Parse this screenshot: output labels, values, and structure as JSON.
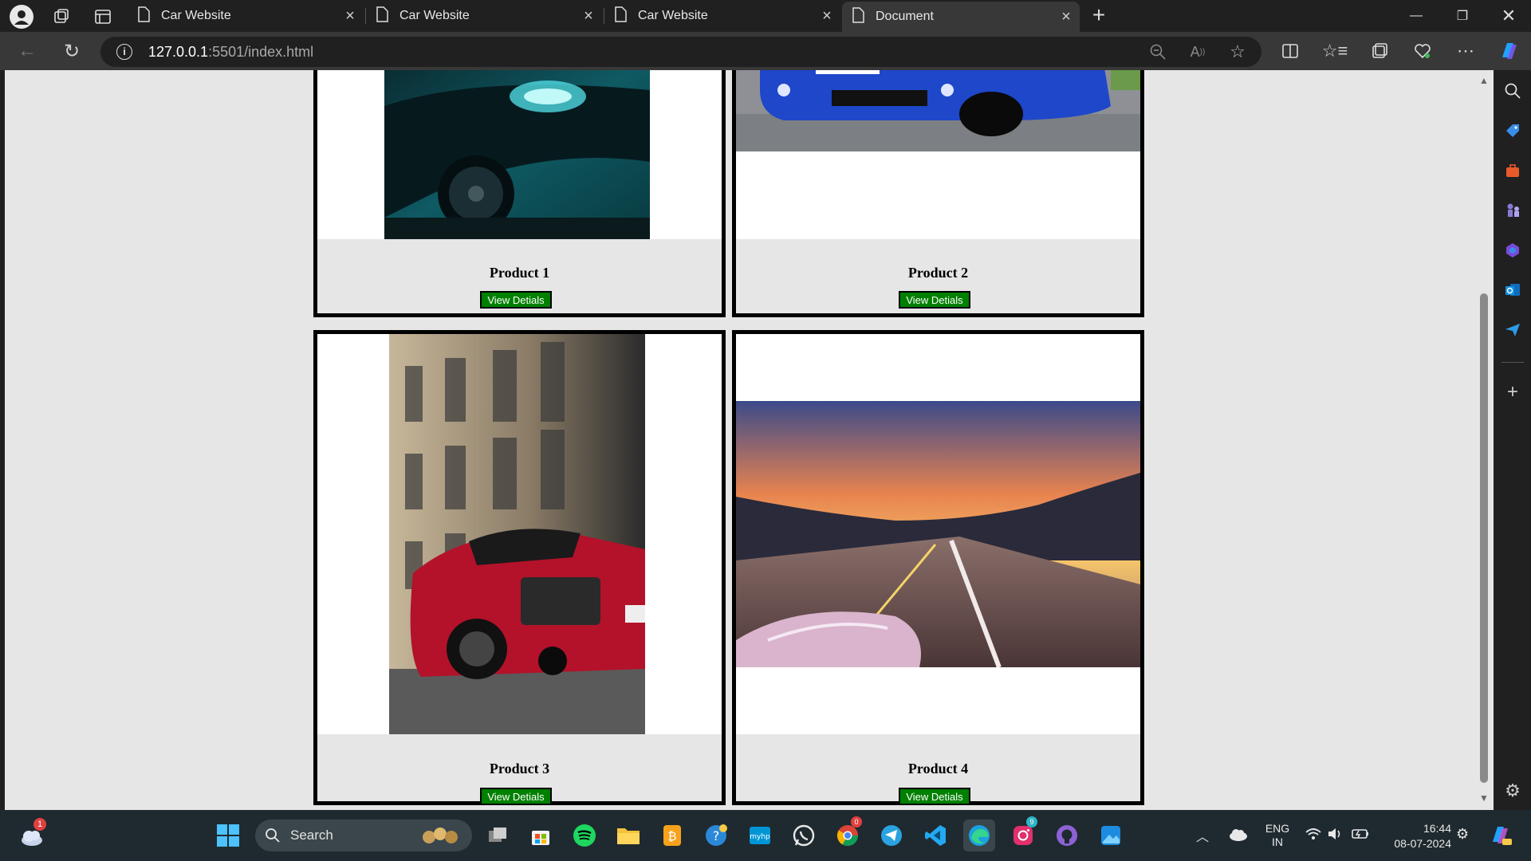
{
  "browser": {
    "tabs": [
      {
        "title": "Car Website",
        "active": false
      },
      {
        "title": "Car Website",
        "active": false
      },
      {
        "title": "Car Website",
        "active": false
      },
      {
        "title": "Document",
        "active": true
      }
    ],
    "url_host": "127.0.0.1",
    "url_rest": ":5501/index.html"
  },
  "page": {
    "products": [
      {
        "name": "Product 1",
        "button": "View Detials"
      },
      {
        "name": "Product 2",
        "button": "View Detials"
      },
      {
        "name": "Product 3",
        "button": "View Detials"
      },
      {
        "name": "Product 4",
        "button": "View Detials"
      }
    ]
  },
  "taskbar": {
    "search_label": "Search",
    "weather_badge": "1",
    "chrome_badge": "0",
    "instagram_badge": "9",
    "lang_primary": "ENG",
    "lang_secondary": "IN",
    "time": "16:44",
    "date": "08-07-2024"
  },
  "colors": {
    "button_green": "#008000",
    "page_bg": "#e6e6e6",
    "card_border": "#000000"
  }
}
